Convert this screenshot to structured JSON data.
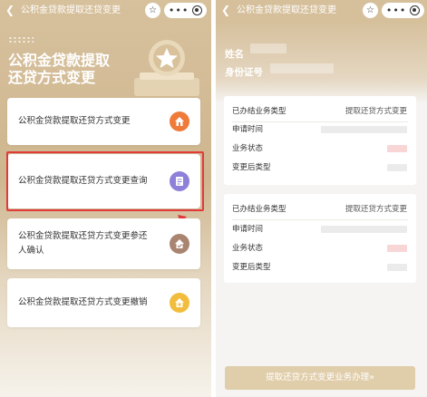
{
  "left": {
    "nav": {
      "back_icon": "chevron-left-icon",
      "title": "公积金贷款提取还贷变更"
    },
    "hero_title_line1": "公积金贷款提取",
    "hero_title_line2": "还贷方式变更",
    "cards": [
      {
        "label": "公积金贷款提取还贷方式变更",
        "icon": "house-icon",
        "icon_color": "#ef7a3a"
      },
      {
        "label": "公积金贷款提取还贷方式变更查询",
        "icon": "document-icon",
        "icon_color": "#8e7fd8"
      },
      {
        "label_line1": "公积金贷款提取还贷方式变更参还",
        "label_line2": "人确认",
        "icon": "house-confirm-icon",
        "icon_color": "#a98470"
      },
      {
        "label": "公积金贷款提取还贷方式变更撤销",
        "icon": "house-cancel-icon",
        "icon_color": "#f2bd3c"
      }
    ],
    "highlight_color": "#e23a3a"
  },
  "right": {
    "nav": {
      "back_icon": "chevron-left-icon",
      "title": "公积金贷款提取还贷变更"
    },
    "name_label": "姓名",
    "id_label": "身份证号",
    "records": [
      {
        "type_label": "已办结业务类型",
        "type_value": "提取还贷方式变更",
        "apply_time_label": "申请时间",
        "status_label": "业务状态",
        "new_type_label": "变更后类型"
      },
      {
        "type_label": "已办结业务类型",
        "type_value": "提取还贷方式变更",
        "apply_time_label": "申请时间",
        "status_label": "业务状态",
        "new_type_label": "变更后类型"
      }
    ],
    "bottom_button": "提取还贷方式变更业务办理»"
  },
  "colors": {
    "brand_gold": "#d6c09c",
    "button_gold": "#e0cda9",
    "highlight_red": "#e23a3a"
  }
}
